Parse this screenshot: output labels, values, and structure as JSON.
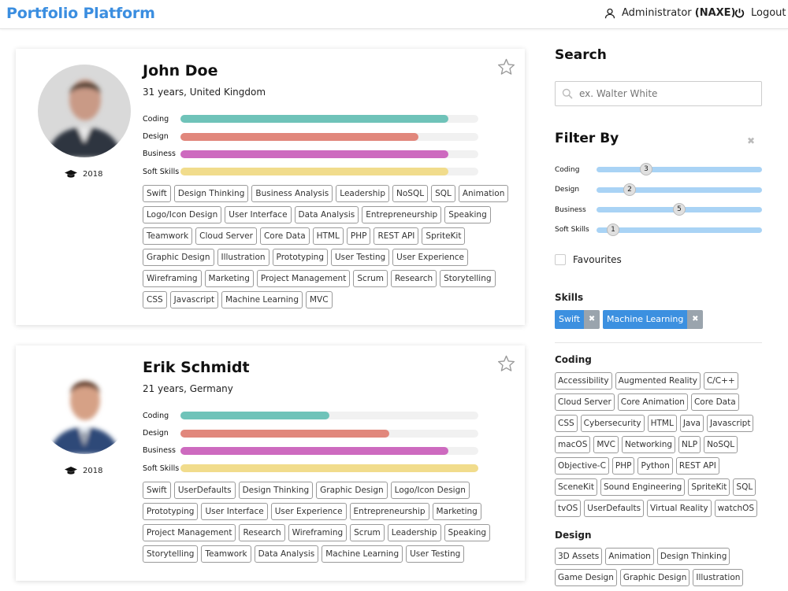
{
  "header": {
    "brand": "Portfolio Platform",
    "user_name": "Administrator",
    "user_code": "(NAXE)",
    "logout_label": "Logout"
  },
  "colors": {
    "accent": "#3b8ee0",
    "coding": "#6fc3b9",
    "design": "#e1877c",
    "business": "#cd6abf",
    "soft_skills": "#f1dc8c"
  },
  "profiles": [
    {
      "name": "John Doe",
      "subtitle": "31 years, United Kingdom",
      "graduation_year": "2018",
      "skills": [
        {
          "label": "Coding",
          "level": 0.9
        },
        {
          "label": "Design",
          "level": 0.8
        },
        {
          "label": "Business",
          "level": 0.9
        },
        {
          "label": "Soft Skills",
          "level": 0.9
        }
      ],
      "tags": [
        "Swift",
        "Design Thinking",
        "Business Analysis",
        "Leadership",
        "NoSQL",
        "SQL",
        "Animation",
        "Logo/Icon Design",
        "User Interface",
        "Data Analysis",
        "Entrepreneurship",
        "Speaking",
        "Teamwork",
        "Cloud Server",
        "Core Data",
        "HTML",
        "PHP",
        "REST API",
        "SpriteKit",
        "Graphic Design",
        "Illustration",
        "Prototyping",
        "User Testing",
        "User Experience",
        "Wireframing",
        "Marketing",
        "Project Management",
        "Scrum",
        "Research",
        "Storytelling",
        "CSS",
        "Javascript",
        "Machine Learning",
        "MVC"
      ]
    },
    {
      "name": "Erik Schmidt",
      "subtitle": "21 years, Germany",
      "graduation_year": "2018",
      "skills": [
        {
          "label": "Coding",
          "level": 0.5
        },
        {
          "label": "Design",
          "level": 0.7
        },
        {
          "label": "Business",
          "level": 0.9
        },
        {
          "label": "Soft Skills",
          "level": 1.0
        }
      ],
      "tags": [
        "Swift",
        "UserDefaults",
        "Design Thinking",
        "Graphic Design",
        "Logo/Icon Design",
        "Prototyping",
        "User Interface",
        "User Experience",
        "Entrepreneurship",
        "Marketing",
        "Project Management",
        "Research",
        "Wireframing",
        "Scrum",
        "Leadership",
        "Speaking",
        "Storytelling",
        "Teamwork",
        "Data Analysis",
        "Machine Learning",
        "User Testing"
      ]
    }
  ],
  "sidebar": {
    "search_title": "Search",
    "search_placeholder": "ex. Walter White",
    "filter_title": "Filter By",
    "filters": [
      {
        "label": "Coding",
        "value": "3",
        "position": 0.3
      },
      {
        "label": "Design",
        "value": "2",
        "position": 0.2
      },
      {
        "label": "Business",
        "value": "5",
        "position": 0.5
      },
      {
        "label": "Soft Skills",
        "value": "1",
        "position": 0.1
      }
    ],
    "favourites_label": "Favourites",
    "skills_title": "Skills",
    "selected_skills": [
      "Swift",
      "Machine Learning"
    ],
    "groups": [
      {
        "title": "Coding",
        "tags": [
          "Accessibility",
          "Augmented Reality",
          "C/C++",
          "Cloud Server",
          "Core Animation",
          "Core Data",
          "CSS",
          "Cybersecurity",
          "HTML",
          "Java",
          "Javascript",
          "macOS",
          "MVC",
          "Networking",
          "NLP",
          "NoSQL",
          "Objective-C",
          "PHP",
          "Python",
          "REST API",
          "SceneKit",
          "Sound Engineering",
          "SpriteKit",
          "SQL",
          "tvOS",
          "UserDefaults",
          "Virtual Reality",
          "watchOS"
        ]
      },
      {
        "title": "Design",
        "tags": [
          "3D Assets",
          "Animation",
          "Design Thinking",
          "Game Design",
          "Graphic Design",
          "Illustration"
        ]
      }
    ]
  }
}
